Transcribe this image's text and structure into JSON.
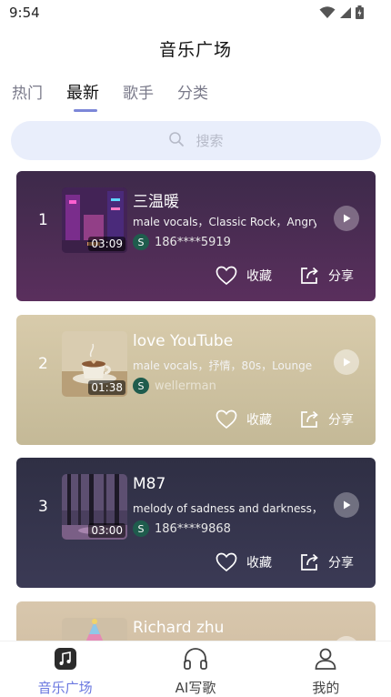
{
  "status_bar": {
    "time": "9:54"
  },
  "header": {
    "title": "音乐广场"
  },
  "tabs": [
    {
      "label": "热门"
    },
    {
      "label": "最新"
    },
    {
      "label": "歌手"
    },
    {
      "label": "分类"
    }
  ],
  "active_tab": "最新",
  "search": {
    "placeholder": "搜索"
  },
  "songs": [
    {
      "rank": "1",
      "title": "三温暖",
      "tags": "male vocals，Classic Rock，Angry",
      "author": "186****5919",
      "author_badge": "S",
      "duration": "03:09",
      "fav_label": "收藏",
      "share_label": "分享"
    },
    {
      "rank": "2",
      "title": "love YouTube",
      "tags": "male vocals，抒情，80s，Lounge",
      "author": "wellerman",
      "author_badge": "S",
      "duration": "01:38",
      "fav_label": "收藏",
      "share_label": "分享"
    },
    {
      "rank": "3",
      "title": "M87",
      "tags": "melody of sadness and darkness，",
      "author": "186****9868",
      "author_badge": "S",
      "duration": "03:00",
      "fav_label": "收藏",
      "share_label": "分享"
    },
    {
      "rank": "",
      "title": "Richard zhu",
      "tags": "",
      "author": "",
      "author_badge": "",
      "duration": "",
      "fav_label": "",
      "share_label": ""
    }
  ],
  "bottom_nav": [
    {
      "label": "音乐广场",
      "icon": "music-note-icon"
    },
    {
      "label": "AI写歌",
      "icon": "headphones-icon"
    },
    {
      "label": "我的",
      "icon": "person-icon"
    }
  ],
  "colors": {
    "accent": "#6b78e0",
    "tab_indicator": "#7c87d8",
    "search_bg": "#e9eefb",
    "card_1": "#4b2d52",
    "card_2": "#d2c5a4",
    "card_3": "#343349",
    "card_4": "#d4c2a6"
  }
}
